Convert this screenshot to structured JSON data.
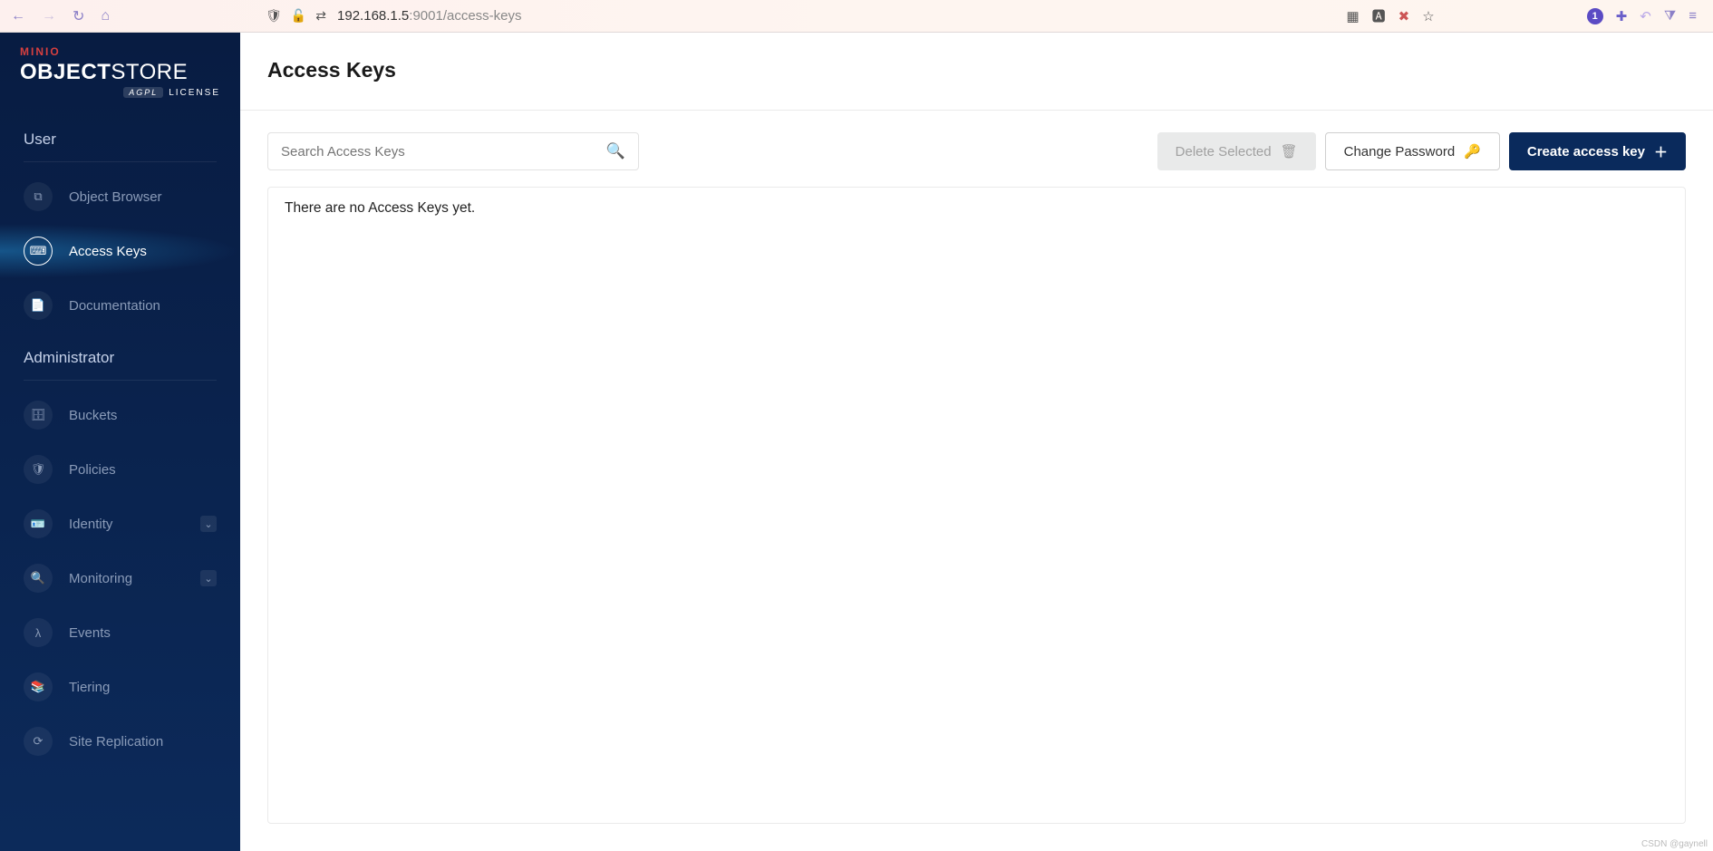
{
  "browser": {
    "url_host": "192.168.1.5",
    "url_rest": ":9001/access-keys",
    "badge": "1"
  },
  "logo": {
    "brand": "MINIO",
    "product_bold": "OBJECT",
    "product_light": "STORE",
    "license_pill": "AGPL",
    "license_label": "LICENSE"
  },
  "sidebar": {
    "section_user": "User",
    "section_admin": "Administrator",
    "user_items": [
      {
        "label": "Object Browser",
        "icon": "⧉"
      },
      {
        "label": "Access Keys",
        "icon": "⌨"
      },
      {
        "label": "Documentation",
        "icon": "📄"
      }
    ],
    "admin_items": [
      {
        "label": "Buckets",
        "icon": "🗄"
      },
      {
        "label": "Policies",
        "icon": "🛡"
      },
      {
        "label": "Identity",
        "icon": "🪪",
        "expandable": true
      },
      {
        "label": "Monitoring",
        "icon": "🔍",
        "expandable": true
      },
      {
        "label": "Events",
        "icon": "λ"
      },
      {
        "label": "Tiering",
        "icon": "📚"
      },
      {
        "label": "Site Replication",
        "icon": "⟳"
      }
    ]
  },
  "page": {
    "title": "Access Keys",
    "search_placeholder": "Search Access Keys",
    "delete_label": "Delete Selected",
    "change_pw_label": "Change Password",
    "create_label": "Create access key",
    "empty_message": "There are no Access Keys yet."
  },
  "watermark": "CSDN @gaynell"
}
